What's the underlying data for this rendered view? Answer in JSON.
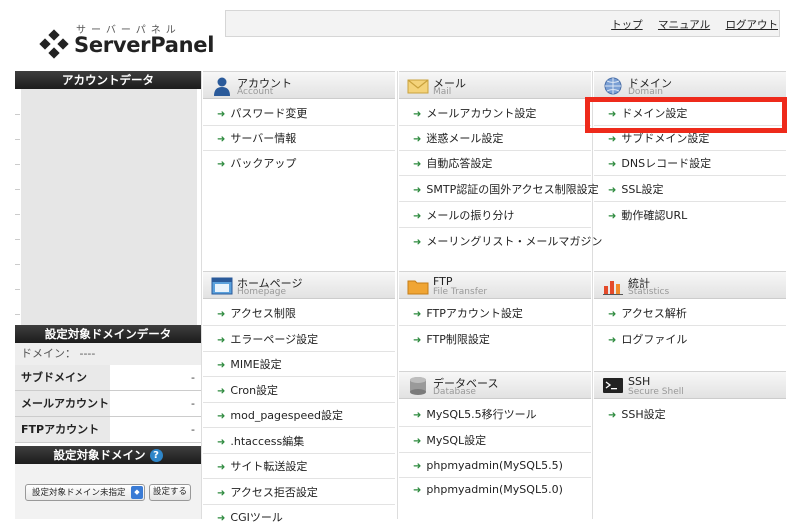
{
  "header": {
    "logo_kana": "サーバーパネル",
    "logo_name": "ServerPanel",
    "links": [
      "トップ",
      "マニュアル",
      "ログアウト"
    ]
  },
  "sidebar": {
    "account_title": "アカウントデータ",
    "domain_title": "設定対象ドメインデータ",
    "domain_line": "ドメイン： ----",
    "rows": [
      {
        "key": "サブドメイン",
        "value": "-"
      },
      {
        "key": "メールアカウント",
        "value": "-"
      },
      {
        "key": "FTPアカウント",
        "value": "-"
      }
    ],
    "select_title": "設定対象ドメイン",
    "select_value": "設定対象ドメイン未指定",
    "set_button": "設定する"
  },
  "sections": {
    "account": {
      "jp": "アカウント",
      "en": "Account",
      "items": [
        "パスワード変更",
        "サーバー情報",
        "バックアップ"
      ]
    },
    "mail": {
      "jp": "メール",
      "en": "Mail",
      "items": [
        "メールアカウント設定",
        "迷惑メール設定",
        "自動応答設定",
        "SMTP認証の国外アクセス制限設定",
        "メールの振り分け",
        "メーリングリスト・メールマガジン"
      ]
    },
    "domain": {
      "jp": "ドメイン",
      "en": "Domain",
      "items": [
        "ドメイン設定",
        "サブドメイン設定",
        "DNSレコード設定",
        "SSL設定",
        "動作確認URL"
      ]
    },
    "homepage": {
      "jp": "ホームページ",
      "en": "Homepage",
      "items": [
        "アクセス制限",
        "エラーページ設定",
        "MIME設定",
        "Cron設定",
        "mod_pagespeed設定",
        ".htaccess編集",
        "サイト転送設定",
        "アクセス拒否設定",
        "CGIツール"
      ]
    },
    "ftp": {
      "jp": "FTP",
      "en": "File Transfer",
      "items": [
        "FTPアカウント設定",
        "FTP制限設定"
      ]
    },
    "stats": {
      "jp": "統計",
      "en": "Statistics",
      "items": [
        "アクセス解析",
        "ログファイル"
      ]
    },
    "database": {
      "jp": "データベース",
      "en": "Database",
      "items": [
        "MySQL5.5移行ツール",
        "MySQL設定",
        "phpmyadmin(MySQL5.5)",
        "phpmyadmin(MySQL5.0)"
      ]
    },
    "ssh": {
      "jp": "SSH",
      "en": "Secure Shell",
      "items": [
        "SSH設定"
      ]
    }
  },
  "colors": {
    "highlight": "#ee2a1b",
    "arrow": "#2d8a3e",
    "help_icon": "#2e86c9"
  }
}
